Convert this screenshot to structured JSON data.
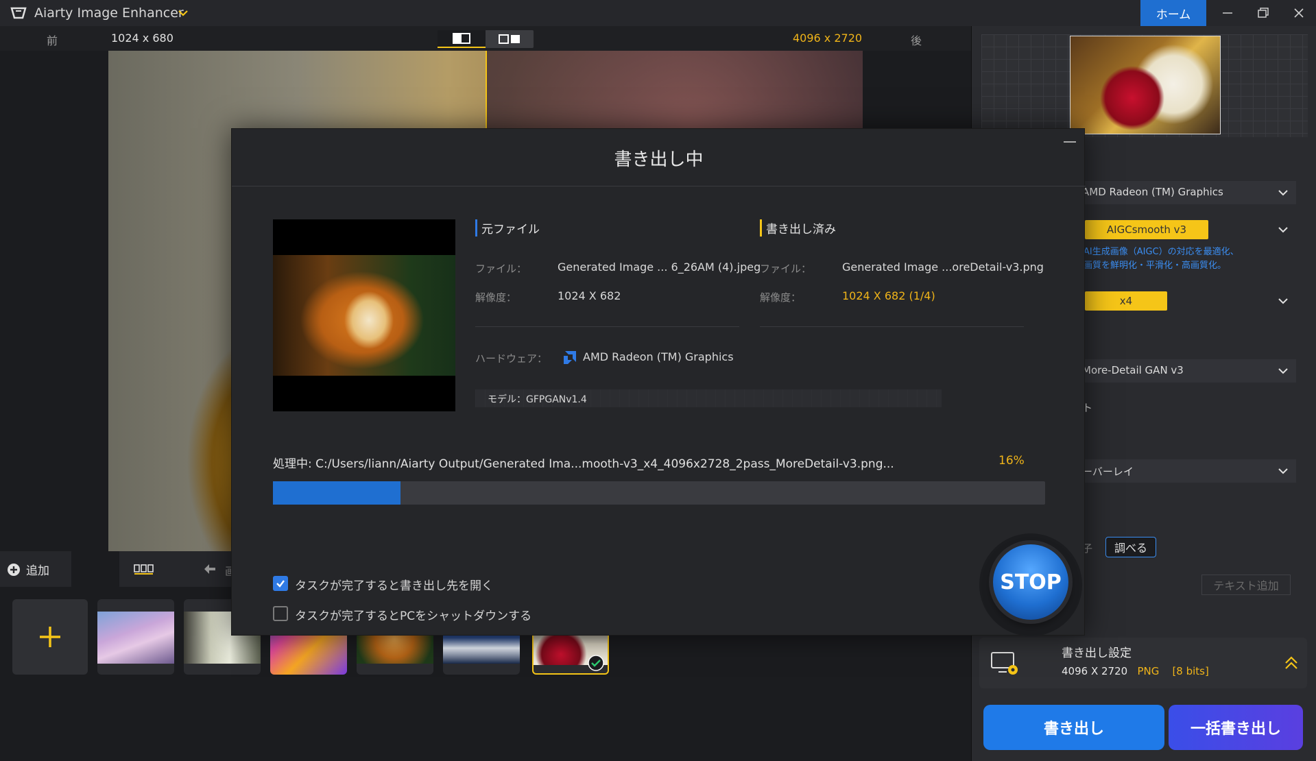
{
  "app": {
    "title": "Aiarty Image Enhancer",
    "home_label": "ホーム"
  },
  "compare": {
    "before_label": "前",
    "before_res": "1024 x 680",
    "after_res": "4096 x 2720",
    "after_label": "後"
  },
  "right_panel": {
    "gpu_select": "AMD Radeon (TM) Graphics",
    "model_chip": "AIGCsmooth  v3",
    "model_note_1": "AI生成画像（AIGC）の対応を最適化、",
    "model_note_2": "画質を鮮明化・平滑化・高画質化。",
    "scale_chip": "x4",
    "second_model": "More-Detail GAN  v3",
    "partial_label": "ト",
    "overlay_select": "ーバーレイ",
    "partial_label2": "子",
    "lookup_button": "調べる",
    "add_text_button": "テキスト追加",
    "export_settings": {
      "title": "書き出し設定",
      "res": "4096 X 2720",
      "format": "PNG",
      "bits": "[8 bits]"
    },
    "export_button": "書き出し",
    "batch_export_button": "一括書き出し"
  },
  "bottom": {
    "add_label": "追加",
    "partial_label": "画"
  },
  "modal": {
    "title": "書き出し中",
    "source_head": "元ファイル",
    "output_head": "書き出し済み",
    "file_label": "ファイル：",
    "res_label": "解像度：",
    "source_file": "Generated Image ... 6_26AM (4).jpeg",
    "source_res": "1024 X 682",
    "output_file": "Generated Image ...oreDetail-v3.png",
    "output_res": "1024 X 682 (1/4)",
    "hardware_label": "ハードウェア：",
    "hardware_value": "AMD Radeon (TM) Graphics",
    "model_text": "モデル：GFPGANv1.4",
    "processing_text": "処理中:  C:/Users/liann/Aiarty Output/Generated Ima...mooth-v3_x4_4096x2728_2pass_MoreDetail-v3.png...",
    "progress_label": "16%",
    "progress": 0.165,
    "checkbox_open": "タスクが完了すると書き出し先を開く",
    "checkbox_open_checked": true,
    "checkbox_shutdown": "タスクが完了するとPCをシャットダウンする",
    "checkbox_shutdown_checked": false,
    "stop_label": "STOP"
  },
  "colors": {
    "accent_blue": "#1f6fd1",
    "accent_yellow": "#f5c518",
    "bg": "#1b1c1f"
  }
}
